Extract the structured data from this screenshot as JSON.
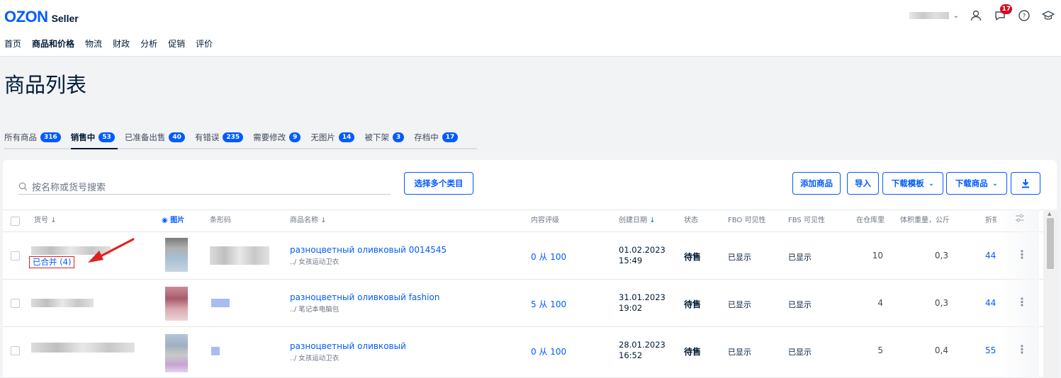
{
  "header": {
    "logo_word": "OZON",
    "logo_sub": "Seller",
    "notification_count": "17",
    "nav": [
      "首页",
      "商品和价格",
      "物流",
      "财政",
      "分析",
      "促销",
      "评价"
    ],
    "active_nav": "商品和价格"
  },
  "page": {
    "title": "商品列表"
  },
  "status_tabs": [
    {
      "label": "所有商品",
      "count": "316"
    },
    {
      "label": "销售中",
      "count": "53"
    },
    {
      "label": "已准备出售",
      "count": "40"
    },
    {
      "label": "有错误",
      "count": "235"
    },
    {
      "label": "需要修改",
      "count": "9"
    },
    {
      "label": "无图片",
      "count": "14"
    },
    {
      "label": "被下架",
      "count": "3"
    },
    {
      "label": "存档中",
      "count": "17"
    }
  ],
  "toolbar": {
    "search_placeholder": "按名称或货号搜索",
    "select_categories": "选择多个类目",
    "add_product": "添加商品",
    "import": "导入",
    "download_template": "下载模板",
    "download_products": "下载商品"
  },
  "table": {
    "headers": {
      "sku": "货号",
      "image": "图片",
      "barcode": "条形码",
      "name": "商品名称",
      "rating": "内容评级",
      "created": "创建日期",
      "status": "状态",
      "fbo": "FBO 可见性",
      "fbs": "FBS 可见性",
      "stock": "在仓库里",
      "volume": "体积重量，公斤",
      "discount": "折扣"
    },
    "merged_label": "已合并 (4)",
    "rows": [
      {
        "name": "разноцветный оливковый 0014545",
        "category": "../ 女孩运动卫衣",
        "rating": "0 从 100",
        "date": "01.02.2023",
        "time": "15:49",
        "status": "待售",
        "fbo": "已显示",
        "fbs": "已显示",
        "stock": "10",
        "volume": "0,3",
        "discount": "44"
      },
      {
        "name": "разноцветный оливковый fashion",
        "category": "../ 笔记本电脑包",
        "rating": "5 从 100",
        "date": "31.01.2023",
        "time": "19:02",
        "status": "待售",
        "fbo": "已显示",
        "fbs": "已显示",
        "stock": "4",
        "volume": "0,3",
        "discount": "44"
      },
      {
        "name": "разноцветный оливковый",
        "category": "../ 女孩运动卫衣",
        "rating": "0 从 100",
        "date": "28.01.2023",
        "time": "16:52",
        "status": "待售",
        "fbo": "已显示",
        "fbs": "已显示",
        "stock": "5",
        "volume": "0,4",
        "discount": "55"
      }
    ]
  },
  "colors": {
    "accent": "#005bff",
    "annotation_red": "#e02020",
    "badge_red": "#d50a1e"
  }
}
